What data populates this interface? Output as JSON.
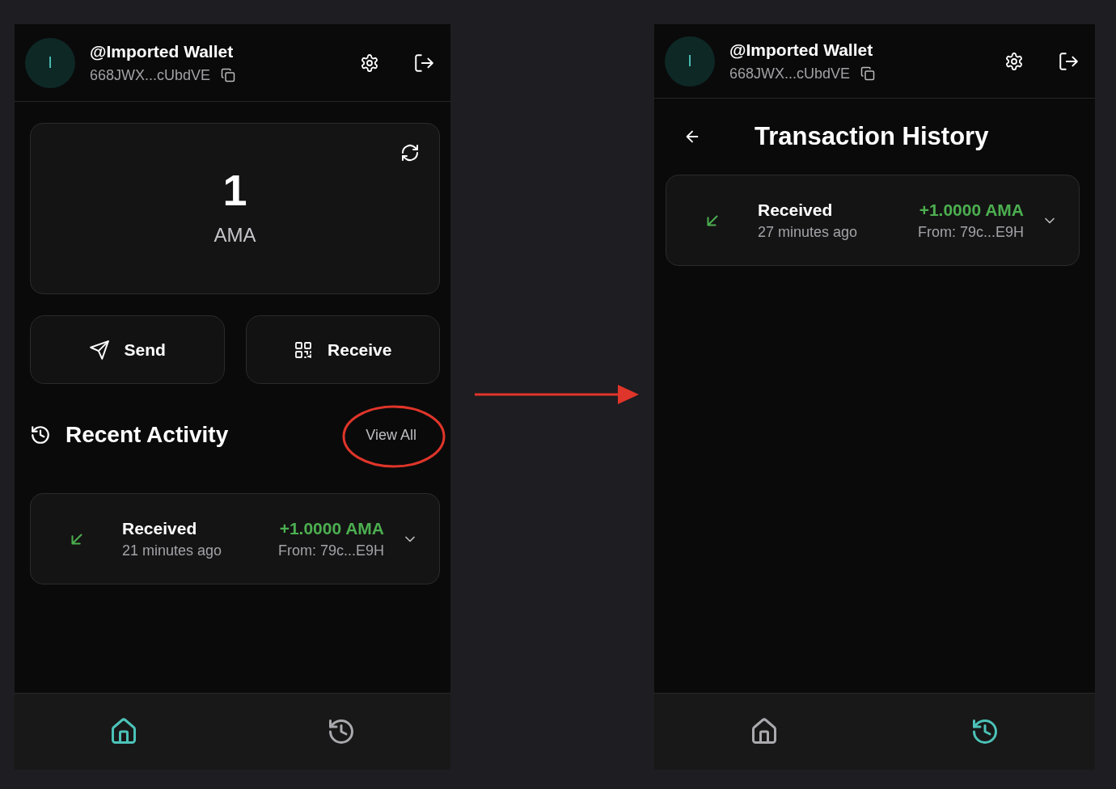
{
  "screens": [
    {
      "kind": "home",
      "header": {
        "avatar": "I",
        "name": "@Imported Wallet",
        "address": "668JWX...cUbdVE"
      },
      "balance": {
        "amount": "1",
        "unit": "AMA"
      },
      "actions": [
        {
          "kind": "send",
          "label": "Send"
        },
        {
          "kind": "receive",
          "label": "Receive"
        }
      ],
      "section": {
        "title": "Recent Activity",
        "link": "View All",
        "circled": true
      },
      "transactions": [
        {
          "kind": "received",
          "title": "Received",
          "time": "21 minutes ago",
          "amount": "+1.0000 AMA",
          "counterparty": "From: 79c...E9H",
          "expanded": false
        }
      ],
      "nav": [
        {
          "kind": "home",
          "selected": true
        },
        {
          "kind": "history",
          "selected": false
        }
      ]
    },
    {
      "kind": "history",
      "header": {
        "avatar": "I",
        "name": "@Imported Wallet",
        "address": "668JWX...cUbdVE"
      },
      "page_title": "Transaction History",
      "transactions": [
        {
          "kind": "received",
          "title": "Received",
          "time": "27 minutes ago",
          "amount": "+1.0000 AMA",
          "counterparty": "From: 79c...E9H",
          "expanded": false
        }
      ],
      "nav": [
        {
          "kind": "home",
          "selected": false
        },
        {
          "kind": "history",
          "selected": true
        }
      ]
    }
  ]
}
